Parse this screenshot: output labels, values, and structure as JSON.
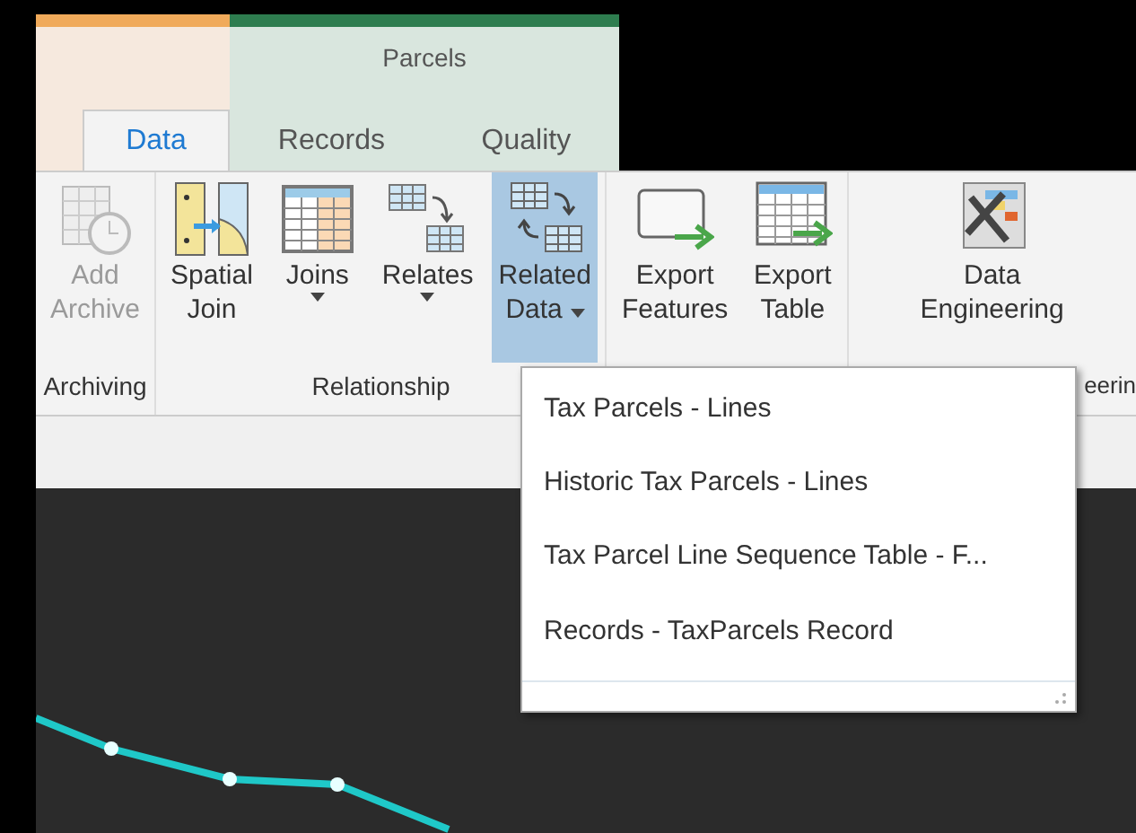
{
  "context_group": {
    "title": "Parcels"
  },
  "tabs": [
    {
      "label": "Data",
      "selected": true
    },
    {
      "label": "Records",
      "selected": false
    },
    {
      "label": "Quality",
      "selected": false
    }
  ],
  "groups": [
    {
      "label": "Archiving",
      "buttons": [
        {
          "lines": [
            "Add",
            "Archive"
          ],
          "kind": "archive",
          "disabled": true,
          "selected": false,
          "dropdown": false
        }
      ]
    },
    {
      "label": "Relationship",
      "buttons": [
        {
          "lines": [
            "Spatial",
            "Join"
          ],
          "kind": "spatial",
          "disabled": false,
          "selected": false,
          "dropdown": false
        },
        {
          "lines": [
            "Joins"
          ],
          "kind": "joins",
          "disabled": false,
          "selected": false,
          "dropdown": true
        },
        {
          "lines": [
            "Relates"
          ],
          "kind": "relates",
          "disabled": false,
          "selected": false,
          "dropdown": true
        },
        {
          "lines": [
            "Related",
            "Data"
          ],
          "kind": "related",
          "disabled": false,
          "selected": true,
          "dropdown": true
        }
      ]
    },
    {
      "buttons": [
        {
          "lines": [
            "Export",
            "Features"
          ],
          "kind": "exportfeat",
          "disabled": false,
          "selected": false,
          "dropdown": false
        },
        {
          "lines": [
            "Export",
            "Table"
          ],
          "kind": "exporttable",
          "disabled": false,
          "selected": false,
          "dropdown": false
        }
      ]
    },
    {
      "label": "eerin",
      "buttons": [
        {
          "lines": [
            "Data",
            "Engineering"
          ],
          "kind": "engineering",
          "disabled": false,
          "selected": false,
          "dropdown": false
        }
      ]
    }
  ],
  "menu": {
    "items": [
      "Tax Parcels - Lines",
      "Historic Tax Parcels - Lines",
      "Tax Parcel Line Sequence Table - F...",
      "Records - TaxParcels Record"
    ]
  }
}
